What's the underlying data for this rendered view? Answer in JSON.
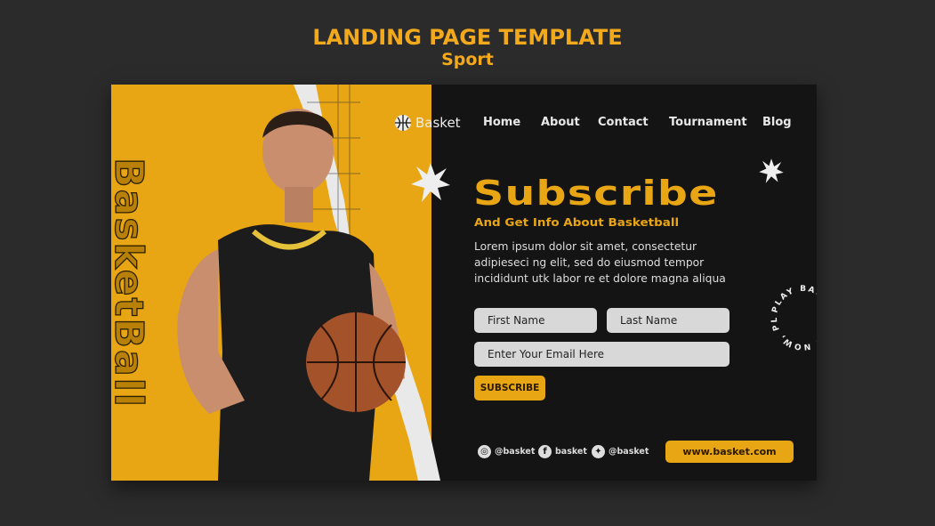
{
  "header": {
    "title": "LANDING PAGE TEMPLATE",
    "subtitle": "Sport"
  },
  "banner": {
    "side_text": "BasketBall",
    "logo": {
      "icon": "basketball-icon",
      "label": "Basket"
    },
    "nav": [
      {
        "label": "Home"
      },
      {
        "label": "About"
      },
      {
        "label": "Contact"
      },
      {
        "label": "Tournament"
      },
      {
        "label": "Blog"
      }
    ],
    "headline": "Subscribe",
    "subheadline": "And Get Info About Basketball",
    "body": "Lorem ipsum dolor sit amet, consectetur adipieseci ng elit, sed do eiusmod tempor incididunt utk labor re et dolore magna aliqua",
    "form": {
      "first_name_placeholder": "First Name",
      "last_name_placeholder": "Last Name",
      "email_placeholder": "Enter Your Email Here",
      "submit_label": "SUBSCRIBE"
    },
    "circle_text": "PLAY BASKETBALL NOW, PLAY BASKETBALL NOW,",
    "social": [
      {
        "icon": "instagram-icon",
        "label": "@basket"
      },
      {
        "icon": "facebook-icon",
        "label": "basket"
      },
      {
        "icon": "twitter-icon",
        "label": "@basket"
      }
    ],
    "website": "www.basket.com"
  },
  "colors": {
    "accent": "#e8a514",
    "background": "#2b2b2b",
    "panel": "#141414"
  }
}
